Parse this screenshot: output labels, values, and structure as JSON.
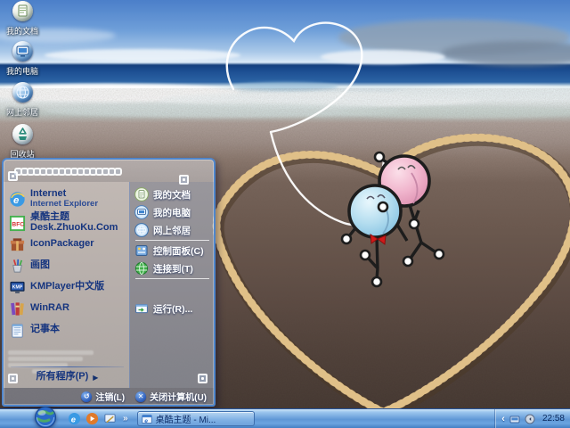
{
  "desktop": {
    "wallpaper_description": "beach shore; heart drawn in sand; white string heart in sky; pink and blue balloon-headed stick figures",
    "icons": [
      {
        "label": "我的文档"
      },
      {
        "label": "我的电脑"
      },
      {
        "label": "网上邻居"
      },
      {
        "label": "回收站"
      }
    ]
  },
  "start_menu": {
    "left_column": {
      "items": [
        {
          "label": "Internet",
          "sublabel": "Internet Explorer"
        },
        {
          "label": "桌酷主题Desk.ZhuoKu.Com"
        },
        {
          "label": "IconPackager"
        },
        {
          "label": "画图"
        },
        {
          "label": "KMPlayer中文版"
        },
        {
          "label": "WinRAR"
        },
        {
          "label": "记事本"
        }
      ],
      "all_programs": "所有程序(P)",
      "all_programs_arrow": "▶"
    },
    "right_column": {
      "items": [
        {
          "label": "我的文档"
        },
        {
          "label": "我的电脑"
        },
        {
          "label": "网上邻居"
        },
        {
          "label": "控制面板(C)"
        },
        {
          "label": "连接到(T)"
        },
        {
          "label": "运行(R)..."
        }
      ]
    },
    "footer": {
      "logoff": "注销(L)",
      "logoff_glyph": "↺",
      "shutdown": "关闭计算机(U)",
      "shutdown_glyph": "✕"
    }
  },
  "taskbar": {
    "quick_launch_overflow": "»",
    "task_buttons": [
      {
        "label": "桌酷主题 - Mi..."
      }
    ],
    "tray": {
      "chevron": "‹",
      "clock": "22:58"
    }
  },
  "icon_art": {
    "ie_letter": "e",
    "zhuoku_letters": "BFC",
    "kmplayer_letters": "KMP"
  },
  "colors": {
    "menu_border": "#4f86cc",
    "menu_left_text": "#16357f",
    "menu_right_text": "#ffffff",
    "taskbar_blue": "#5f97d6",
    "sand_ridge": "#c9a56e",
    "balloon_pink": "#eeaac4",
    "balloon_blue": "#a8d8ee",
    "string_white": "#ffffff"
  }
}
